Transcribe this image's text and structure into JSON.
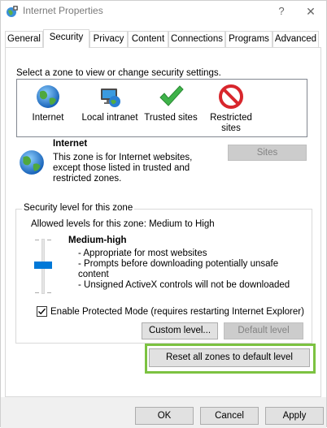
{
  "window": {
    "title": "Internet Properties",
    "help_glyph": "?",
    "close_glyph": "✕"
  },
  "tabs": [
    {
      "label": "General",
      "active": false
    },
    {
      "label": "Security",
      "active": true
    },
    {
      "label": "Privacy",
      "active": false
    },
    {
      "label": "Content",
      "active": false
    },
    {
      "label": "Connections",
      "active": false
    },
    {
      "label": "Programs",
      "active": false
    },
    {
      "label": "Advanced",
      "active": false
    }
  ],
  "security": {
    "prompt": "Select a zone to view or change security settings.",
    "zones": [
      {
        "label": "Internet",
        "icon": "globe-icon"
      },
      {
        "label": "Local intranet",
        "icon": "network-computer-icon"
      },
      {
        "label": "Trusted sites",
        "icon": "checkmark-icon"
      },
      {
        "label": "Restricted sites",
        "icon": "restricted-icon",
        "line1": "Restricted",
        "line2": "sites"
      }
    ],
    "selected_zone": {
      "name": "Internet",
      "description": "This zone is for Internet websites, except those listed in trusted and restricted zones.",
      "desc_line1": "This zone is for Internet websites,",
      "desc_line2": "except those listed in trusted and",
      "desc_line3": "restricted zones."
    },
    "sites_button": "Sites",
    "level_group": {
      "legend": "Security level for this zone",
      "allowed": "Allowed levels for this zone: Medium to High",
      "level_name": "Medium-high",
      "lines": [
        "- Appropriate for most websites",
        "- Prompts before downloading potentially unsafe",
        "content",
        "- Unsigned ActiveX controls will not be downloaded"
      ],
      "slider_level": "Medium-high"
    },
    "protected_mode": {
      "label": "Enable Protected Mode (requires restarting Internet Explorer)",
      "checked": true
    },
    "custom_level_button": "Custom level...",
    "default_level_button": "Default level",
    "reset_button": "Reset all zones to default level"
  },
  "footer": {
    "ok": "OK",
    "cancel": "Cancel",
    "apply": "Apply"
  },
  "colors": {
    "accent": "#0078d7",
    "highlight": "#7cc241"
  }
}
